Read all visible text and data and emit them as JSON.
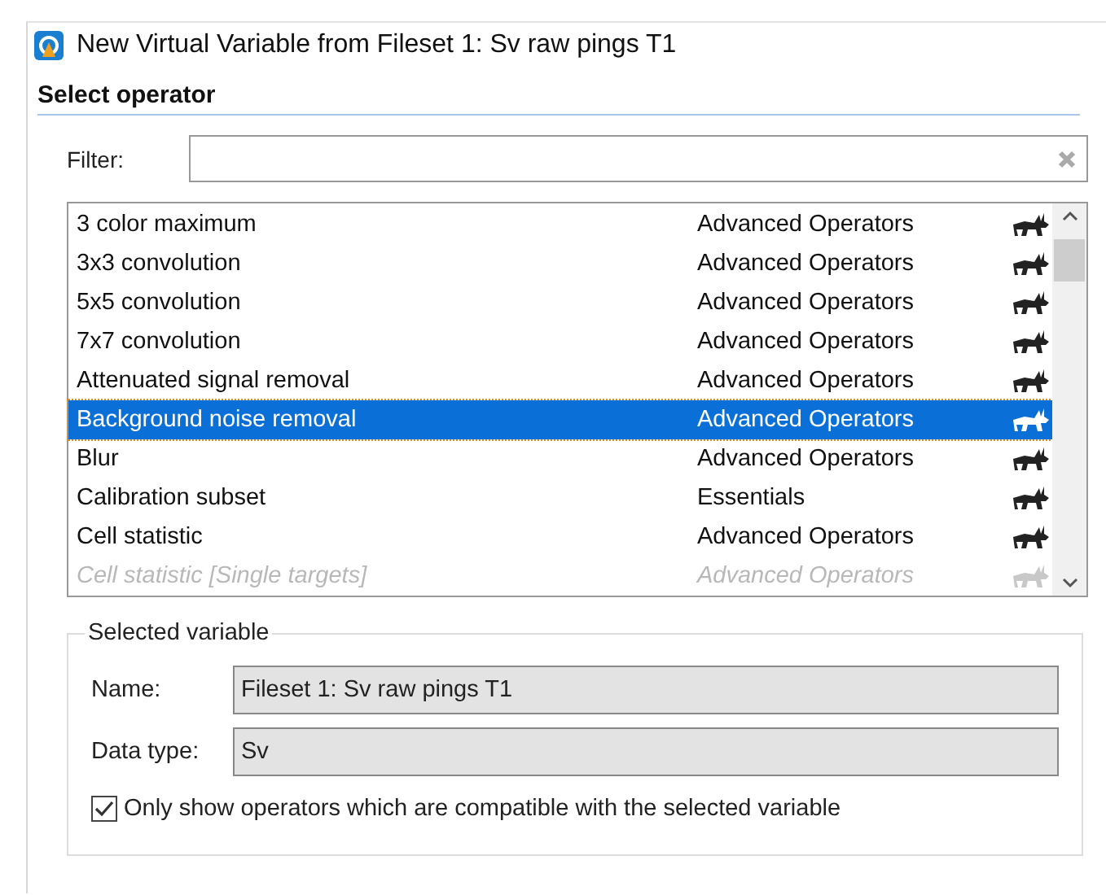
{
  "window": {
    "title": "New Virtual Variable from Fileset 1: Sv raw pings T1"
  },
  "section": {
    "title": "Select operator"
  },
  "filter": {
    "label": "Filter:"
  },
  "operators": [
    {
      "name": "3 color maximum",
      "category": "Advanced Operators",
      "selected": false,
      "disabled": false
    },
    {
      "name": "3x3 convolution",
      "category": "Advanced Operators",
      "selected": false,
      "disabled": false
    },
    {
      "name": "5x5 convolution",
      "category": "Advanced Operators",
      "selected": false,
      "disabled": false
    },
    {
      "name": "7x7 convolution",
      "category": "Advanced Operators",
      "selected": false,
      "disabled": false
    },
    {
      "name": "Attenuated signal removal",
      "category": "Advanced Operators",
      "selected": false,
      "disabled": false
    },
    {
      "name": "Background noise removal",
      "category": "Advanced Operators",
      "selected": true,
      "disabled": false
    },
    {
      "name": "Blur",
      "category": "Advanced Operators",
      "selected": false,
      "disabled": false
    },
    {
      "name": "Calibration subset",
      "category": "Essentials",
      "selected": false,
      "disabled": false
    },
    {
      "name": "Cell statistic",
      "category": "Advanced Operators",
      "selected": false,
      "disabled": false
    },
    {
      "name": "Cell statistic [Single targets]",
      "category": "Advanced Operators",
      "selected": false,
      "disabled": true
    }
  ],
  "selected_variable": {
    "title": "Selected variable",
    "fields": [
      {
        "label": "Name:",
        "value": "Fileset 1: Sv raw pings T1"
      },
      {
        "label": "Data type:",
        "value": "Sv"
      }
    ],
    "compatible_only": {
      "label": "Only show operators which are compatible with the selected variable",
      "checked": true
    }
  }
}
